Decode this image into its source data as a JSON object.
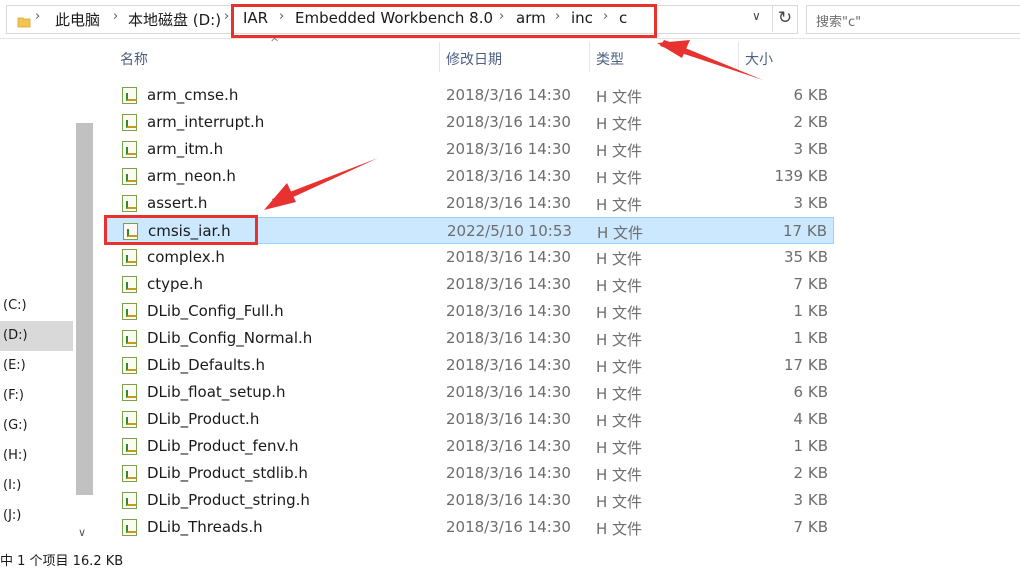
{
  "address": {
    "crumbs": [
      "此电脑",
      "本地磁盘 (D:)",
      "IAR",
      "Embedded Workbench 8.0",
      "arm",
      "inc",
      "c"
    ],
    "search_placeholder": "搜索\"c\""
  },
  "nav": {
    "drives": [
      "(C:)",
      "(D:)",
      "(E:)",
      "(F:)",
      "(G:)",
      "(H:)",
      "(I:)",
      "(J:)"
    ],
    "selected": "(D:)"
  },
  "columns": {
    "name": "名称",
    "date": "修改日期",
    "type": "类型",
    "size": "大小"
  },
  "files": [
    {
      "name": "arm_cmse.h",
      "date": "2018/3/16 14:30",
      "type": "H 文件",
      "size": "6 KB"
    },
    {
      "name": "arm_interrupt.h",
      "date": "2018/3/16 14:30",
      "type": "H 文件",
      "size": "2 KB"
    },
    {
      "name": "arm_itm.h",
      "date": "2018/3/16 14:30",
      "type": "H 文件",
      "size": "3 KB"
    },
    {
      "name": "arm_neon.h",
      "date": "2018/3/16 14:30",
      "type": "H 文件",
      "size": "139 KB"
    },
    {
      "name": "assert.h",
      "date": "2018/3/16 14:30",
      "type": "H 文件",
      "size": "3 KB"
    },
    {
      "name": "cmsis_iar.h",
      "date": "2022/5/10 10:53",
      "type": "H 文件",
      "size": "17 KB"
    },
    {
      "name": "complex.h",
      "date": "2018/3/16 14:30",
      "type": "H 文件",
      "size": "35 KB"
    },
    {
      "name": "ctype.h",
      "date": "2018/3/16 14:30",
      "type": "H 文件",
      "size": "7 KB"
    },
    {
      "name": "DLib_Config_Full.h",
      "date": "2018/3/16 14:30",
      "type": "H 文件",
      "size": "1 KB"
    },
    {
      "name": "DLib_Config_Normal.h",
      "date": "2018/3/16 14:30",
      "type": "H 文件",
      "size": "1 KB"
    },
    {
      "name": "DLib_Defaults.h",
      "date": "2018/3/16 14:30",
      "type": "H 文件",
      "size": "17 KB"
    },
    {
      "name": "DLib_float_setup.h",
      "date": "2018/3/16 14:30",
      "type": "H 文件",
      "size": "6 KB"
    },
    {
      "name": "DLib_Product.h",
      "date": "2018/3/16 14:30",
      "type": "H 文件",
      "size": "4 KB"
    },
    {
      "name": "DLib_Product_fenv.h",
      "date": "2018/3/16 14:30",
      "type": "H 文件",
      "size": "1 KB"
    },
    {
      "name": "DLib_Product_stdlib.h",
      "date": "2018/3/16 14:30",
      "type": "H 文件",
      "size": "2 KB"
    },
    {
      "name": "DLib_Product_string.h",
      "date": "2018/3/16 14:30",
      "type": "H 文件",
      "size": "3 KB"
    },
    {
      "name": "DLib_Threads.h",
      "date": "2018/3/16 14:30",
      "type": "H 文件",
      "size": "7 KB"
    }
  ],
  "selected_file": "cmsis_iar.h",
  "status": "中 1 个项目  16.2 KB",
  "colors": {
    "selection_bg": "#cce8ff",
    "annotation_red": "#e8322f"
  }
}
